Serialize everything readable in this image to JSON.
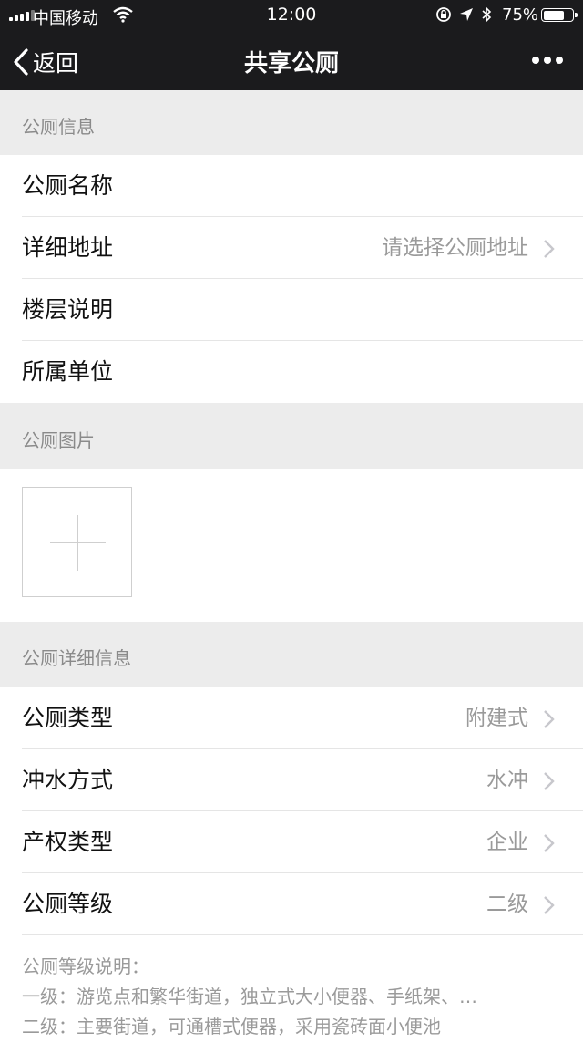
{
  "status_bar": {
    "carrier": "中国移动",
    "time": "12:00",
    "battery_pct": "75%",
    "battery_level": 0.75
  },
  "nav": {
    "back_label": "返回",
    "title": "共享公厕"
  },
  "section_info": {
    "header": "公厕信息",
    "rows": [
      {
        "label": "公厕名称",
        "value": ""
      },
      {
        "label": "详细地址",
        "value": "请选择公厕地址"
      },
      {
        "label": "楼层说明",
        "value": ""
      },
      {
        "label": "所属单位",
        "value": ""
      }
    ]
  },
  "section_photos": {
    "header": "公厕图片"
  },
  "section_detail": {
    "header": "公厕详细信息",
    "rows": [
      {
        "label": "公厕类型",
        "value": "附建式"
      },
      {
        "label": "冲水方式",
        "value": "水冲"
      },
      {
        "label": "产权类型",
        "value": "企业"
      },
      {
        "label": "公厕等级",
        "value": "二级"
      }
    ]
  },
  "grade_notes": {
    "title": "公厕等级说明：",
    "lines": [
      "一级：游览点和繁华街道，独立式大小便器、手纸架、…",
      "二级：主要街道，可通槽式便器，采用瓷砖面小便池"
    ]
  }
}
